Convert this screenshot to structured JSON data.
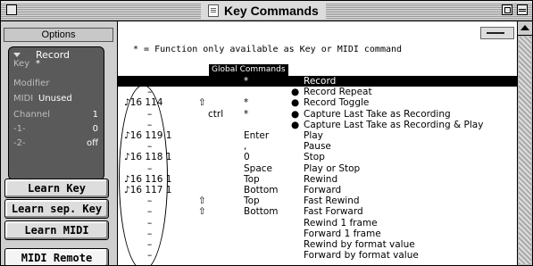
{
  "window": {
    "title": "Key Commands"
  },
  "left_panel": {
    "options_label": "Options",
    "record_label": "Record",
    "info_rows": [
      {
        "key": "Key",
        "value": "*"
      },
      {
        "key": "Modifier",
        "value": ""
      },
      {
        "key": "MIDI",
        "value": "Unused"
      },
      {
        "key": "Channel",
        "value": "1"
      },
      {
        "key": "-1-",
        "value": "0"
      },
      {
        "key": "-2-",
        "value": "off"
      }
    ],
    "buttons": {
      "learn_key": "Learn Key",
      "learn_sep_key": "Learn sep. Key",
      "learn_midi": "Learn MIDI",
      "midi_remote": "MIDI Remote"
    }
  },
  "main": {
    "note": "* = Function only available as Key or MIDI command",
    "category": "Global Commands",
    "rows": [
      {
        "midi": "",
        "shift": "",
        "ctrl": "",
        "key": "*",
        "dot": "",
        "name": "Record",
        "selected": true
      },
      {
        "midi": "–",
        "shift": "",
        "ctrl": "",
        "key": "",
        "dot": "●",
        "name": "Record Repeat"
      },
      {
        "midi": "♪16 114",
        "shift": "⇧",
        "ctrl": "",
        "key": "*",
        "dot": "●",
        "name": "Record Toggle"
      },
      {
        "midi": "–",
        "shift": "",
        "ctrl": "ctrl",
        "key": "*",
        "dot": "●",
        "name": "Capture Last Take as Recording"
      },
      {
        "midi": "–",
        "shift": "",
        "ctrl": "",
        "key": "",
        "dot": "●",
        "name": "Capture Last Take as Recording & Play"
      },
      {
        "midi": "♪16 119 1",
        "shift": "",
        "ctrl": "",
        "key": "Enter",
        "dot": "",
        "name": "Play"
      },
      {
        "midi": "–",
        "shift": "",
        "ctrl": "",
        "key": ",",
        "dot": "",
        "name": "Pause"
      },
      {
        "midi": "♪16 118 1",
        "shift": "",
        "ctrl": "",
        "key": "0",
        "dot": "",
        "name": "Stop"
      },
      {
        "midi": "–",
        "shift": "",
        "ctrl": "",
        "key": "Space",
        "dot": "",
        "name": "Play or Stop"
      },
      {
        "midi": "♪16 116 1",
        "shift": "",
        "ctrl": "",
        "key": "Top",
        "dot": "",
        "name": "Rewind"
      },
      {
        "midi": "♪16 117 1",
        "shift": "",
        "ctrl": "",
        "key": "Bottom",
        "dot": "",
        "name": "Forward"
      },
      {
        "midi": "–",
        "shift": "⇧",
        "ctrl": "",
        "key": "Top",
        "dot": "",
        "name": "Fast Rewind"
      },
      {
        "midi": "–",
        "shift": "⇧",
        "ctrl": "",
        "key": "Bottom",
        "dot": "",
        "name": "Fast Forward"
      },
      {
        "midi": "–",
        "shift": "",
        "ctrl": "",
        "key": "",
        "dot": "",
        "name": "Rewind 1 frame"
      },
      {
        "midi": "–",
        "shift": "",
        "ctrl": "",
        "key": "",
        "dot": "",
        "name": "Forward 1 frame"
      },
      {
        "midi": "–",
        "shift": "",
        "ctrl": "",
        "key": "",
        "dot": "",
        "name": "Rewind by format value"
      },
      {
        "midi": "–",
        "shift": "",
        "ctrl": "",
        "key": "",
        "dot": "",
        "name": "Forward by format value"
      }
    ]
  }
}
